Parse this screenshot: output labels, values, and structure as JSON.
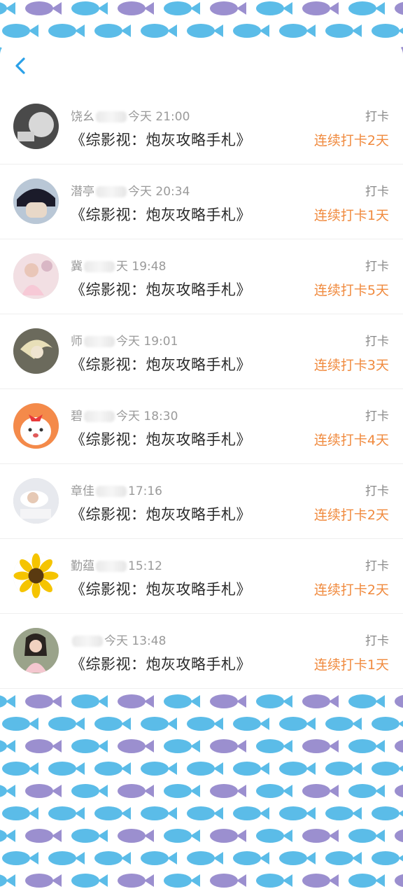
{
  "header": {
    "back_icon": "chevron-left-icon"
  },
  "entries": [
    {
      "name": "饶幺",
      "time": "今天 21:00",
      "book": "《综影视：炮灰攻略手札》",
      "action": "打卡",
      "streak": "连续打卡2天",
      "avatar": "gray-portrait"
    },
    {
      "name": "潜亭",
      "time": "今天 20:34",
      "book": "《综影视：炮灰攻略手札》",
      "action": "打卡",
      "streak": "连续打卡1天",
      "avatar": "anime-boy"
    },
    {
      "name": "冀",
      "time": "天 19:48",
      "book": "《综影视：炮灰攻略手札》",
      "action": "打卡",
      "streak": "连续打卡5天",
      "avatar": "pink-girl"
    },
    {
      "name": "师",
      "time": "今天 19:01",
      "book": "《综影视：炮灰攻略手札》",
      "action": "打卡",
      "streak": "连续打卡3天",
      "avatar": "blonde-art"
    },
    {
      "name": "碧",
      "time": "今天 18:30",
      "book": "《综影视：炮灰攻略手札》",
      "action": "打卡",
      "streak": "连续打卡4天",
      "avatar": "cartoon-dog"
    },
    {
      "name": "章佳",
      "time": "17:16",
      "book": "《综影视：炮灰攻略手札》",
      "action": "打卡",
      "streak": "连续打卡2天",
      "avatar": "sleeping-girl"
    },
    {
      "name": "勤蕴",
      "time": "15:12",
      "book": "《综影视：炮灰攻略手札》",
      "action": "打卡",
      "streak": "连续打卡2天",
      "avatar": "sunflower"
    },
    {
      "name": "",
      "time": "今天 13:48",
      "book": "《综影视：炮灰攻略手札》",
      "action": "打卡",
      "streak": "连续打卡1天",
      "avatar": "child-photo"
    }
  ],
  "colors": {
    "streak": "#f08a3e",
    "fish_blue": "#5bbce8",
    "fish_purple": "#9b8fcf",
    "accent": "#2aa0e8"
  }
}
